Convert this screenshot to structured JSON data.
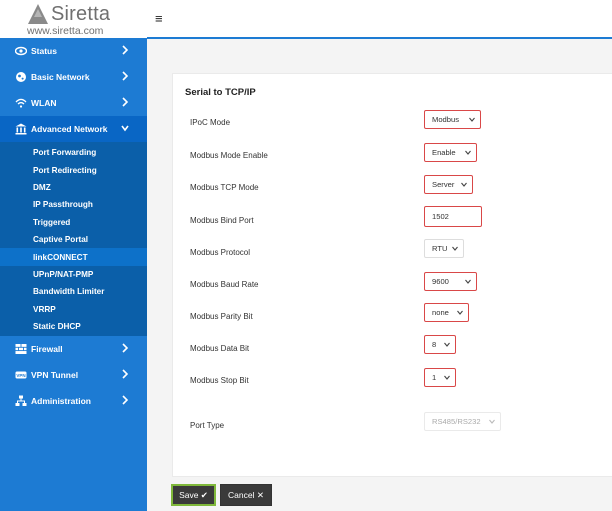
{
  "brand": {
    "name": "Siretta",
    "url": "www.siretta.com"
  },
  "topbar": {
    "menu_icon": "≡"
  },
  "nav": {
    "status": "Status",
    "basic_network": "Basic Network",
    "wlan": "WLAN",
    "advanced_network": "Advanced Network",
    "advanced_sub": [
      "Port Forwarding",
      "Port Redirecting",
      "DMZ",
      "IP Passthrough",
      "Triggered",
      "Captive Portal",
      "linkCONNECT",
      "UPnP/NAT-PMP",
      "Bandwidth Limiter",
      "VRRP",
      "Static DHCP"
    ],
    "firewall": "Firewall",
    "vpn_tunnel": "VPN Tunnel",
    "administration": "Administration"
  },
  "section": {
    "title": "Serial to TCP/IP",
    "fields": [
      {
        "label": "IPoC Mode",
        "value": "Modbus"
      },
      {
        "label": "Modbus Mode Enable",
        "value": "Enable"
      },
      {
        "label": "Modbus TCP Mode",
        "value": "Server"
      },
      {
        "label": "Modbus Bind Port",
        "value": "1502"
      },
      {
        "label": "Modbus Protocol",
        "value": "RTU"
      },
      {
        "label": "Modbus Baud Rate",
        "value": "9600"
      },
      {
        "label": "Modbus Parity Bit",
        "value": "none"
      },
      {
        "label": "Modbus Data Bit",
        "value": "8"
      },
      {
        "label": "Modbus Stop Bit",
        "value": "1"
      },
      {
        "label": "Port Type",
        "value": "RS485/RS232"
      }
    ]
  },
  "actions": {
    "save": "Save ✔",
    "cancel": "Cancel ✕"
  },
  "colors": {
    "sidebar": "#1d7bd3",
    "submenu": "#0b5fa9",
    "highlight": "#d94848",
    "save_border": "#7fb83a"
  }
}
